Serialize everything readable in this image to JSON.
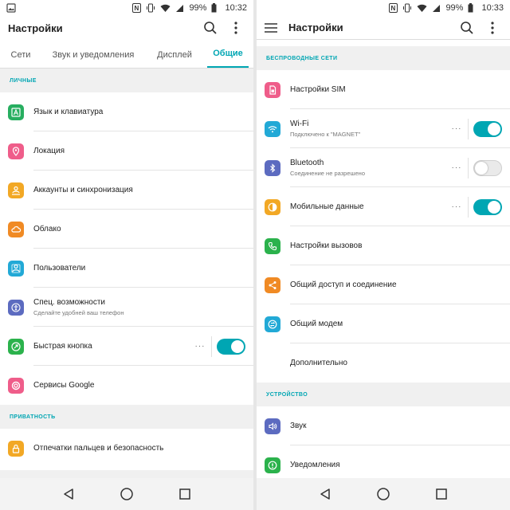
{
  "colors": {
    "accent": "#00a6b3"
  },
  "left": {
    "status": {
      "battery": "99%",
      "time": "10:32"
    },
    "title": "Настройки",
    "tabs": [
      "Сети",
      "Звук и уведомления",
      "Дисплей",
      "Общие"
    ],
    "active_tab": "Общие",
    "section_personal": "ЛИЧНЫЕ",
    "items": [
      {
        "label": "Язык и клавиатура",
        "icon": "keyboard-icon",
        "color": "#27ae60"
      },
      {
        "label": "Локация",
        "icon": "location-icon",
        "color": "#ef5d8a"
      },
      {
        "label": "Аккаунты и синхронизация",
        "icon": "accounts-icon",
        "color": "#f2a825"
      },
      {
        "label": "Облако",
        "icon": "cloud-icon",
        "color": "#f08a24"
      },
      {
        "label": "Пользователи",
        "icon": "users-icon",
        "color": "#22a9d6"
      },
      {
        "label": "Спец. возможности",
        "sub": "Сделайте удобней ваш телефон",
        "icon": "accessibility-icon",
        "color": "#5c6bc0"
      },
      {
        "label": "Быстрая кнопка",
        "icon": "quick-button-icon",
        "color": "#2bb24c",
        "toggle": "on"
      },
      {
        "label": "Сервисы Google",
        "icon": "google-icon",
        "color": "#ef5d8a"
      }
    ],
    "section_privacy": "ПРИВАТНОСТЬ",
    "privacy_items": [
      {
        "label": "Отпечатки пальцев и безопасность",
        "icon": "lock-icon",
        "color": "#f2a825"
      }
    ]
  },
  "right": {
    "status": {
      "battery": "99%",
      "time": "10:33"
    },
    "title": "Настройки",
    "section_wireless": "БЕСПРОВОДНЫЕ СЕТИ",
    "items": [
      {
        "label": "Настройки SIM",
        "icon": "sim-icon",
        "color": "#ef5d8a"
      },
      {
        "label": "Wi-Fi",
        "sub": "Подключено к \"MAGNET\"",
        "icon": "wifi-icon",
        "color": "#22a9d6",
        "toggle": "on"
      },
      {
        "label": "Bluetooth",
        "sub": "Соединение не разрешено",
        "icon": "bluetooth-icon",
        "color": "#5c6bc0",
        "toggle": "off"
      },
      {
        "label": "Мобильные данные",
        "icon": "mobile-data-icon",
        "color": "#f2a825",
        "toggle": "on"
      },
      {
        "label": "Настройки вызовов",
        "icon": "phone-icon",
        "color": "#2bb24c"
      },
      {
        "label": "Общий доступ и соединение",
        "icon": "share-icon",
        "color": "#f08a24"
      },
      {
        "label": "Общий модем",
        "icon": "tethering-icon",
        "color": "#22a9d6"
      },
      {
        "label": "Дополнительно",
        "icon": ""
      }
    ],
    "section_device": "УСТРОЙСТВО",
    "device_items": [
      {
        "label": "Звук",
        "icon": "sound-icon",
        "color": "#5c6bc0"
      },
      {
        "label": "Уведомления",
        "icon": "notification-icon",
        "color": "#2bb24c"
      }
    ]
  }
}
